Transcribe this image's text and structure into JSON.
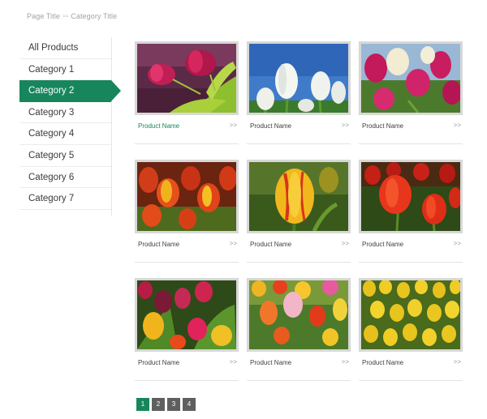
{
  "breadcrumb": {
    "page_title": "Page Title",
    "separator": ">>",
    "category_title": "Category Title"
  },
  "sidebar": {
    "items": [
      {
        "label": "All Products",
        "active": false
      },
      {
        "label": "Category 1",
        "active": false
      },
      {
        "label": "Category 2",
        "active": true
      },
      {
        "label": "Category 3",
        "active": false
      },
      {
        "label": "Category 4",
        "active": false
      },
      {
        "label": "Category 5",
        "active": false
      },
      {
        "label": "Category 6",
        "active": false
      },
      {
        "label": "Category 7",
        "active": false
      }
    ]
  },
  "products": [
    {
      "name": "Product Name",
      "arrow": ">>",
      "image": "pink-tulips-closeup",
      "highlighted": true
    },
    {
      "name": "Product Name",
      "arrow": ">>",
      "image": "white-tulips-sky",
      "highlighted": false
    },
    {
      "name": "Product Name",
      "arrow": ">>",
      "image": "pink-and-white-tulips",
      "highlighted": false
    },
    {
      "name": "Product Name",
      "arrow": ">>",
      "image": "red-yellow-tulips-field",
      "highlighted": false
    },
    {
      "name": "Product Name",
      "arrow": ">>",
      "image": "yellow-red-tulip-closeup",
      "highlighted": false
    },
    {
      "name": "Product Name",
      "arrow": ">>",
      "image": "red-tulips",
      "highlighted": false
    },
    {
      "name": "Product Name",
      "arrow": ">>",
      "image": "mixed-tulips",
      "highlighted": false
    },
    {
      "name": "Product Name",
      "arrow": ">>",
      "image": "colorful-tulips-garden",
      "highlighted": false
    },
    {
      "name": "Product Name",
      "arrow": ">>",
      "image": "yellow-tulips-field",
      "highlighted": false
    }
  ],
  "pagination": {
    "pages": [
      "1",
      "2",
      "3",
      "4"
    ],
    "current": "1"
  },
  "colors": {
    "accent": "#17865d",
    "page_button": "#5f5f5f",
    "thumb_border": "#d8d8d8"
  }
}
